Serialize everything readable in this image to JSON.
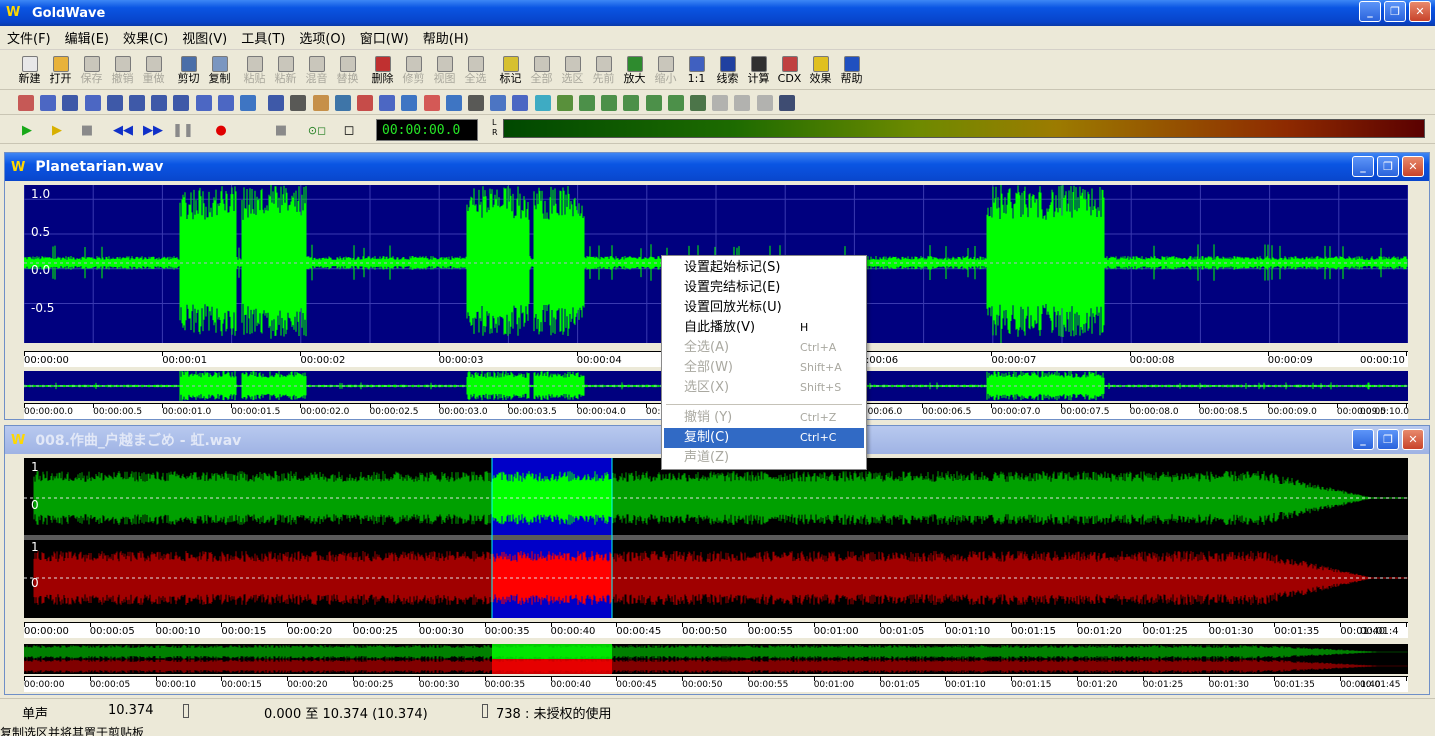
{
  "app": {
    "title": "GoldWave",
    "logo_text": "W"
  },
  "menu": [
    "文件(F)",
    "编辑(E)",
    "效果(C)",
    "视图(V)",
    "工具(T)",
    "选项(O)",
    "窗口(W)",
    "帮助(H)"
  ],
  "toolbar_main": [
    {
      "label": "新建",
      "icon": "new-icon",
      "enabled": true
    },
    {
      "label": "打开",
      "icon": "open-icon",
      "enabled": true
    },
    {
      "label": "保存",
      "icon": "save-icon",
      "enabled": false
    },
    {
      "label": "撤销",
      "icon": "undo-icon",
      "enabled": false
    },
    {
      "label": "重做",
      "icon": "redo-icon",
      "enabled": false
    },
    {
      "label": "剪切",
      "icon": "cut-icon",
      "enabled": true
    },
    {
      "label": "复制",
      "icon": "copy-icon",
      "enabled": true
    },
    {
      "label": "粘贴",
      "icon": "paste-icon",
      "enabled": false
    },
    {
      "label": "粘新",
      "icon": "paste-new-icon",
      "enabled": false
    },
    {
      "label": "混音",
      "icon": "mix-icon",
      "enabled": false
    },
    {
      "label": "替换",
      "icon": "replace-icon",
      "enabled": false
    },
    {
      "label": "删除",
      "icon": "delete-icon",
      "enabled": true
    },
    {
      "label": "修剪",
      "icon": "trim-icon",
      "enabled": false
    },
    {
      "label": "视图",
      "icon": "view-icon",
      "enabled": false
    },
    {
      "label": "全选",
      "icon": "select-all-icon",
      "enabled": false
    },
    {
      "label": "标记",
      "icon": "marker-icon",
      "enabled": true
    },
    {
      "label": "全部",
      "icon": "zoom-all-icon",
      "enabled": false
    },
    {
      "label": "选区",
      "icon": "zoom-selection-icon",
      "enabled": false
    },
    {
      "label": "先前",
      "icon": "zoom-previous-icon",
      "enabled": false
    },
    {
      "label": "放大",
      "icon": "zoom-in-icon",
      "enabled": true
    },
    {
      "label": "缩小",
      "icon": "zoom-out-icon",
      "enabled": false
    },
    {
      "label": "1:1",
      "icon": "zoom-1to1-icon",
      "enabled": true
    },
    {
      "label": "线索",
      "icon": "cue-icon",
      "enabled": true
    },
    {
      "label": "计算",
      "icon": "calculator-icon",
      "enabled": true
    },
    {
      "label": "CDX",
      "icon": "cd-icon",
      "enabled": true
    },
    {
      "label": "效果",
      "icon": "effects-icon",
      "enabled": true
    },
    {
      "label": "帮助",
      "icon": "help-icon",
      "enabled": true
    }
  ],
  "colors": {
    "wave_bg": "#00007f",
    "wave_green": "#00ff00",
    "wave_dark_green": "#008000",
    "wave_red": "#ff0000",
    "wave_dark_red": "#800000",
    "selection_bg": "#0000ff",
    "menu_highlight": "#316ac5"
  },
  "transport": {
    "time": "00:00:00.0",
    "meter_labels": [
      "L",
      "R"
    ]
  },
  "doc1": {
    "title": "Planetarian.wav",
    "amp_labels": [
      "1.0",
      "0.5",
      "0.0",
      "-0.5"
    ],
    "ruler": [
      "00:00:00",
      "00:00:01",
      "00:00:02",
      "00:00:03",
      "00:00:04",
      "00:00:05",
      "00:00:06",
      "00:00:07",
      "00:00:08",
      "00:00:09",
      "00:00:10"
    ],
    "overview_ruler": [
      "00:00:00.0",
      "00:00:00.5",
      "00:00:01.0",
      "00:00:01.5",
      "00:00:02.0",
      "00:00:02.5",
      "00:00:03.0",
      "00:00:03.5",
      "00:00:04.0",
      "00:00:04.5",
      "00:00:05.0",
      "00:00:05.5",
      "00:00:06.0",
      "00:00:06.5",
      "00:00:07.0",
      "00:00:07.5",
      "00:00:08.0",
      "00:00:08.5",
      "00:00:09.0",
      "00:00:09.5",
      "00:00:10.0"
    ]
  },
  "doc2": {
    "title": "008.作曲_户越まごめ - 虹.wav",
    "amp_labels": [
      "1",
      "0",
      "1",
      "0"
    ],
    "ruler": [
      "00:00:00",
      "00:00:05",
      "00:00:10",
      "00:00:15",
      "00:00:20",
      "00:00:25",
      "00:00:30",
      "00:00:35",
      "00:00:40",
      "00:00:45",
      "00:00:50",
      "00:00:55",
      "00:01:00",
      "00:01:05",
      "00:01:10",
      "00:01:15",
      "00:01:20",
      "00:01:25",
      "00:01:30",
      "00:01:35",
      "00:01:40",
      "00:01:4"
    ],
    "overview_ruler": [
      "00:00:00",
      "00:00:05",
      "00:00:10",
      "00:00:15",
      "00:00:20",
      "00:00:25",
      "00:00:30",
      "00:00:35",
      "00:00:40",
      "00:00:45",
      "00:00:50",
      "00:00:55",
      "00:01:00",
      "00:01:05",
      "00:01:10",
      "00:01:15",
      "00:01:20",
      "00:01:25",
      "00:01:30",
      "00:01:35",
      "00:01:40",
      "00:01:45"
    ]
  },
  "context_menu": [
    {
      "label": "设置起始标记(S)",
      "shortcut": "",
      "enabled": true
    },
    {
      "label": "设置完结标记(E)",
      "shortcut": "",
      "enabled": true
    },
    {
      "label": "设置回放光标(U)",
      "shortcut": "",
      "enabled": true
    },
    {
      "label": "自此播放(V)",
      "shortcut": "H",
      "enabled": true
    },
    {
      "label": "全选(A)",
      "shortcut": "Ctrl+A",
      "enabled": false
    },
    {
      "label": "全部(W)",
      "shortcut": "Shift+A",
      "enabled": false
    },
    {
      "label": "选区(X)",
      "shortcut": "Shift+S",
      "enabled": false
    },
    {
      "label": "撤销 (Y)",
      "shortcut": "Ctrl+Z",
      "enabled": false
    },
    {
      "label": "复制(C)",
      "shortcut": "Ctrl+C",
      "enabled": true,
      "highlighted": true
    },
    {
      "label": "声道(Z)",
      "shortcut": "",
      "enabled": false
    }
  ],
  "status": {
    "channel": "单声",
    "length": "10.374",
    "selection": "0.000 至 10.374 (10.374)",
    "info": "738 : 未授权的使用",
    "hint": "复制选区并将其置于剪贴板"
  }
}
